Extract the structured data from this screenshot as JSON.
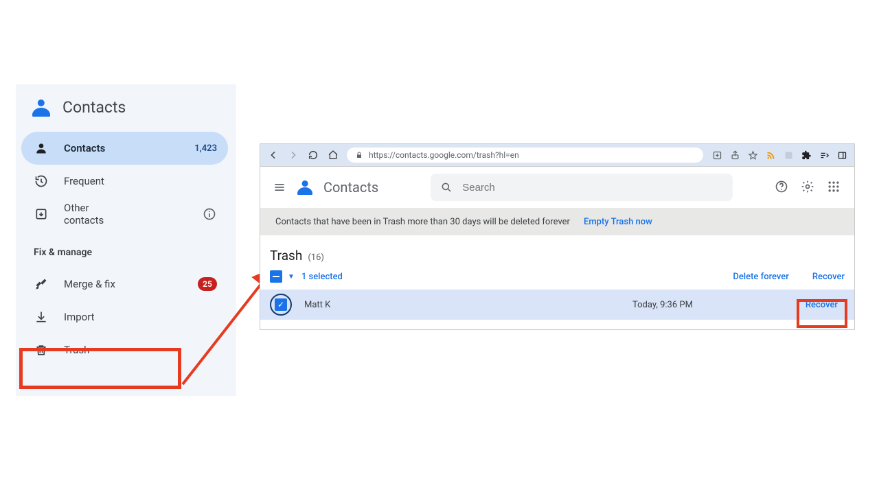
{
  "sidebar": {
    "brand": "Contacts",
    "items": [
      {
        "label": "Contacts",
        "count": "1,423"
      },
      {
        "label": "Frequent"
      },
      {
        "label": "Other contacts"
      }
    ],
    "section_title": "Fix & manage",
    "manage": [
      {
        "label": "Merge & fix",
        "badge": "25"
      },
      {
        "label": "Import"
      },
      {
        "label": "Trash"
      }
    ]
  },
  "browser": {
    "url": "https://contacts.google.com/trash?hl=en"
  },
  "app": {
    "title": "Contacts",
    "search_placeholder": "Search",
    "notice": "Contacts that have been in Trash more than 30 days will be deleted forever",
    "empty_link": "Empty Trash now",
    "page_title": "Trash",
    "page_count": "(16)",
    "selected_text": "1 selected",
    "delete_forever": "Delete forever",
    "recover": "Recover"
  },
  "row": {
    "name": "Matt K",
    "date": "Today, 9:36 PM",
    "recover": "Recover"
  }
}
